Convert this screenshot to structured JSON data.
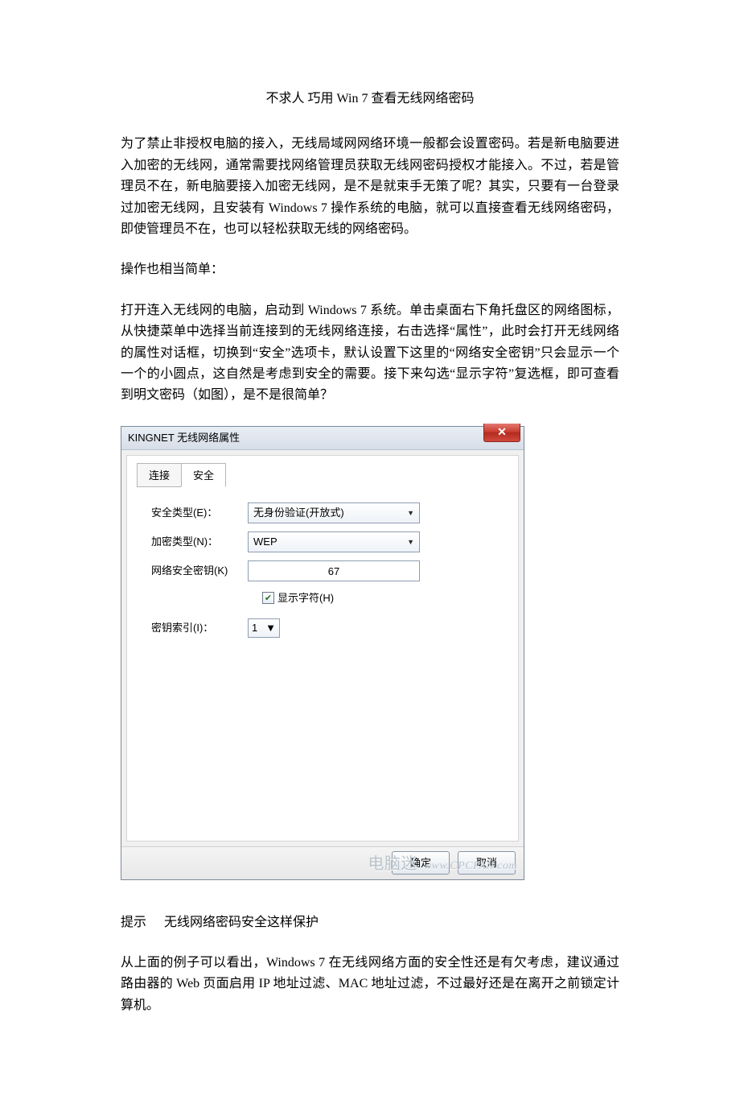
{
  "article": {
    "title": "不求人 巧用 Win 7 查看无线网络密码",
    "para1": "为了禁止非授权电脑的接入，无线局域网网络环境一般都会设置密码。若是新电脑要进入加密的无线网，通常需要找网络管理员获取无线网密码授权才能接入。不过，若是管理员不在，新电脑要接入加密无线网，是不是就束手无策了呢？其实，只要有一台登录过加密无线网，且安装有 Windows 7 操作系统的电脑，就可以直接查看无线网络密码，即使管理员不在，也可以轻松获取无线的网络密码。",
    "para2": "操作也相当简单：",
    "para3": "打开连入无线网的电脑，启动到 Windows 7 系统。单击桌面右下角托盘区的网络图标，从快捷菜单中选择当前连接到的无线网络连接，右击选择“属性”，此时会打开无线网络的属性对话框，切换到“安全”选项卡，默认设置下这里的“网络安全密钥”只会显示一个一个的小圆点，这自然是考虑到安全的需要。接下来勾选“显示字符”复选框，即可查看到明文密码（如图），是不是很简单？",
    "para4_label": "提示",
    "para4_heading": "无线网络密码安全这样保护",
    "para5": "从上面的例子可以看出，Windows 7 在无线网络方面的安全性还是有欠考虑，建议通过路由器的 Web 页面启用 IP 地址过滤、MAC 地址过滤，不过最好还是在离开之前锁定计算机。"
  },
  "dialog": {
    "window_title": "KINGNET 无线网络属性",
    "close_glyph": "✕",
    "tabs": {
      "connect": "连接",
      "security": "安全"
    },
    "fields": {
      "security_type_label": "安全类型(E)：",
      "security_type_value": "无身份验证(开放式)",
      "encryption_label": "加密类型(N)：",
      "encryption_value": "WEP",
      "key_label": "网络安全密钥(K)",
      "key_value": "67",
      "show_chars_label": "显示字符(H)",
      "key_index_label": "密钥索引(I)：",
      "key_index_value": "1"
    },
    "buttons": {
      "ok": "确定",
      "cancel": "取消"
    },
    "watermark_cn": "电脑迷",
    "watermark_en": "www.CPCFAN.com"
  }
}
